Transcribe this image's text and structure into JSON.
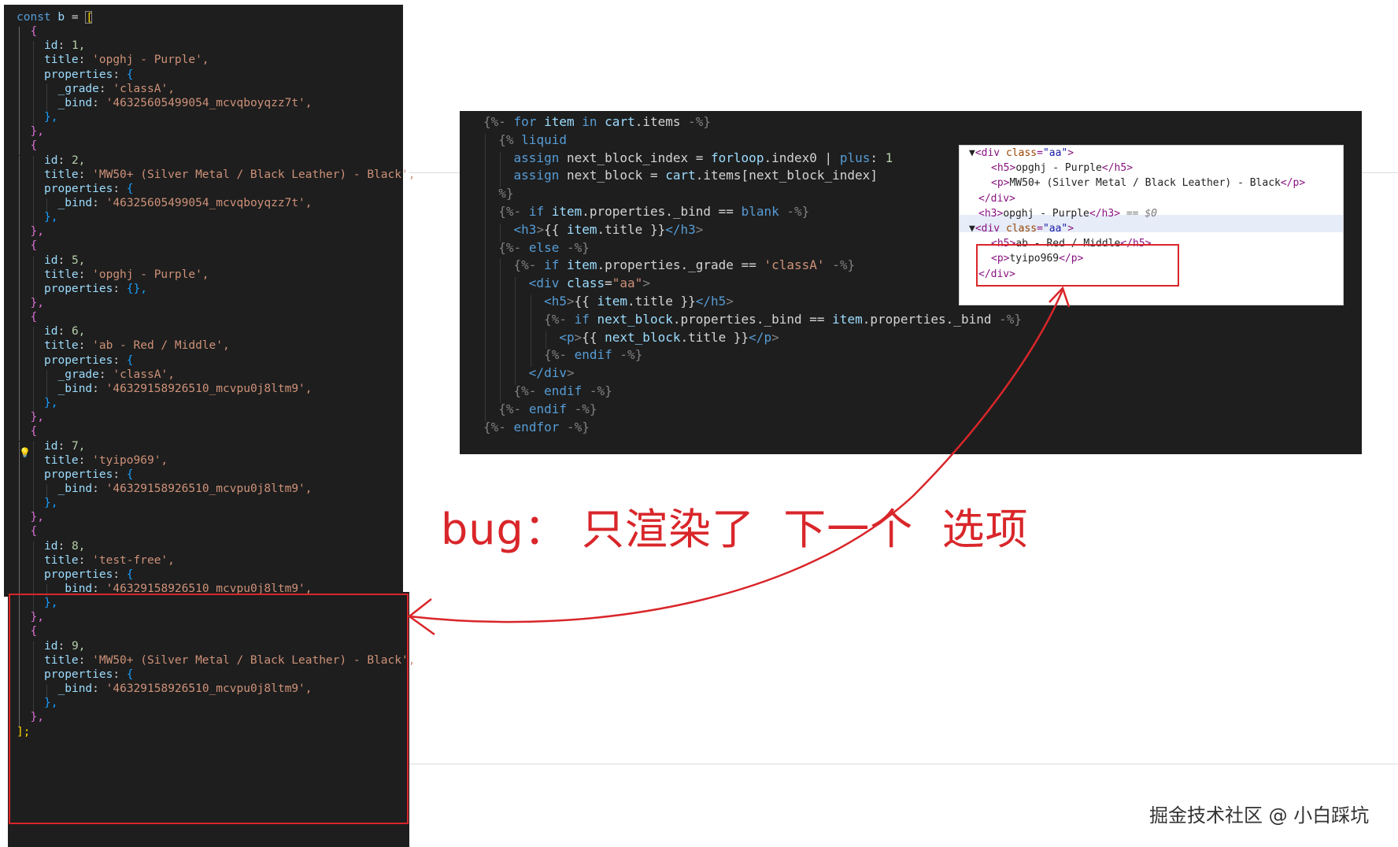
{
  "left_code": {
    "lines": [
      {
        "indent": 0,
        "text": "const b = [",
        "kind": "decl"
      },
      {
        "indent": 1,
        "text": "{",
        "kind": "brace"
      },
      {
        "indent": 2,
        "key": "id",
        "value": "1,",
        "vkind": "num"
      },
      {
        "indent": 2,
        "key": "title",
        "value": "'opghj - Purple',",
        "vkind": "str"
      },
      {
        "indent": 2,
        "key": "properties",
        "value": "{",
        "vkind": "brace"
      },
      {
        "indent": 3,
        "key": "_grade",
        "value": "'classA',",
        "vkind": "str"
      },
      {
        "indent": 3,
        "key": "_bind",
        "value": "'46325605499054_mcvqboyqzz7t',",
        "vkind": "str"
      },
      {
        "indent": 2,
        "text": "},",
        "kind": "brace"
      },
      {
        "indent": 1,
        "text": "},",
        "kind": "brace"
      },
      {
        "indent": 1,
        "text": "{",
        "kind": "brace"
      },
      {
        "indent": 2,
        "key": "id",
        "value": "2,",
        "vkind": "num"
      },
      {
        "indent": 2,
        "key": "title",
        "value": "'MW50+ (Silver Metal / Black Leather) - Black',",
        "vkind": "str"
      },
      {
        "indent": 2,
        "key": "properties",
        "value": "{",
        "vkind": "brace"
      },
      {
        "indent": 3,
        "key": "_bind",
        "value": "'46325605499054_mcvqboyqzz7t',",
        "vkind": "str"
      },
      {
        "indent": 2,
        "text": "},",
        "kind": "brace"
      },
      {
        "indent": 1,
        "text": "},",
        "kind": "brace"
      },
      {
        "indent": 1,
        "text": "{",
        "kind": "brace"
      },
      {
        "indent": 2,
        "key": "id",
        "value": "5,",
        "vkind": "num"
      },
      {
        "indent": 2,
        "key": "title",
        "value": "'opghj - Purple',",
        "vkind": "str"
      },
      {
        "indent": 2,
        "key": "properties",
        "value": "{},",
        "vkind": "brace"
      },
      {
        "indent": 1,
        "text": "},",
        "kind": "brace"
      },
      {
        "indent": 1,
        "text": "{",
        "kind": "brace"
      },
      {
        "indent": 2,
        "key": "id",
        "value": "6,",
        "vkind": "num"
      },
      {
        "indent": 2,
        "key": "title",
        "value": "'ab - Red / Middle',",
        "vkind": "str"
      },
      {
        "indent": 2,
        "key": "properties",
        "value": "{",
        "vkind": "brace"
      },
      {
        "indent": 3,
        "key": "_grade",
        "value": "'classA',",
        "vkind": "str"
      },
      {
        "indent": 3,
        "key": "_bind",
        "value": "'46329158926510_mcvpu0j8ltm9',",
        "vkind": "str"
      },
      {
        "indent": 2,
        "text": "},",
        "kind": "brace"
      },
      {
        "indent": 1,
        "text": "},",
        "kind": "brace"
      },
      {
        "indent": 1,
        "text": "{",
        "kind": "brace"
      },
      {
        "indent": 2,
        "key": "id",
        "value": "7,",
        "vkind": "num"
      },
      {
        "indent": 2,
        "key": "title",
        "value": "'tyipo969',",
        "vkind": "str"
      },
      {
        "indent": 2,
        "key": "properties",
        "value": "{",
        "vkind": "brace"
      },
      {
        "indent": 3,
        "key": "_bind",
        "value": "'46329158926510_mcvpu0j8ltm9',",
        "vkind": "str"
      },
      {
        "indent": 2,
        "text": "},",
        "kind": "brace"
      },
      {
        "indent": 1,
        "text": "},",
        "kind": "brace"
      },
      {
        "indent": 1,
        "text": "{",
        "kind": "brace"
      },
      {
        "indent": 2,
        "key": "id",
        "value": "8,",
        "vkind": "num"
      },
      {
        "indent": 2,
        "key": "title",
        "value": "'test-free',",
        "vkind": "str"
      },
      {
        "indent": 2,
        "key": "properties",
        "value": "{",
        "vkind": "brace"
      },
      {
        "indent": 3,
        "key": "_bind",
        "value": "'46329158926510_mcvpu0j8ltm9',",
        "vkind": "str"
      },
      {
        "indent": 2,
        "text": "},",
        "kind": "brace"
      },
      {
        "indent": 1,
        "text": "},",
        "kind": "brace"
      },
      {
        "indent": 1,
        "text": "{",
        "kind": "brace"
      },
      {
        "indent": 2,
        "key": "id",
        "value": "9,",
        "vkind": "num"
      },
      {
        "indent": 2,
        "key": "title",
        "value": "'MW50+ (Silver Metal / Black Leather) - Black',",
        "vkind": "str"
      },
      {
        "indent": 2,
        "key": "properties",
        "value": "{",
        "vkind": "brace"
      },
      {
        "indent": 3,
        "key": "_bind",
        "value": "'46329158926510_mcvpu0j8ltm9',",
        "vkind": "str"
      },
      {
        "indent": 2,
        "text": "},",
        "kind": "brace"
      },
      {
        "indent": 1,
        "text": "},",
        "kind": "brace"
      },
      {
        "indent": 0,
        "text": "];",
        "kind": "brace"
      }
    ]
  },
  "template_code": {
    "lines": [
      "{%- for item in cart.items -%}",
      "  {% liquid",
      "    assign next_block_index = forloop.index0 | plus: 1",
      "    assign next_block = cart.items[next_block_index]",
      "  %}",
      "  {%- if item.properties._bind == blank -%}",
      "    <h3>{{ item.title }}</h3>",
      "  {%- else -%}",
      "    {%- if item.properties._grade == 'classA' -%}",
      "      <div class=\"aa\">",
      "        <h5>{{ item.title }}</h5>",
      "        {%- if next_block.properties._bind == item.properties._bind -%}",
      "          <p>{{ next_block.title }}</p>",
      "        {%- endif -%}",
      "      </div>",
      "    {%- endif -%}",
      "  {%- endif -%}",
      "{%- endfor -%}"
    ]
  },
  "devtools": {
    "lines": [
      {
        "indent": 0,
        "arrow": "▼",
        "open": "<div ",
        "attr": "class",
        "val": "\"aa\"",
        "close": ">"
      },
      {
        "indent": 1,
        "tag_open": "<h5>",
        "text": "opghj - Purple",
        "tag_close": "</h5>"
      },
      {
        "indent": 1,
        "tag_open": "<p>",
        "text": "MW50+ (Silver Metal / Black Leather) - Black",
        "tag_close": "</p>"
      },
      {
        "indent": 0,
        "tag_open": "</div>",
        "text": "",
        "tag_close": ""
      },
      {
        "indent": 0,
        "tag_open": "<h3>",
        "text": "opghj - Purple",
        "tag_close": "</h3>",
        "ref": " == $0",
        "selected": true
      },
      {
        "indent": 0,
        "arrow": "▼",
        "open": "<div ",
        "attr": "class",
        "val": "\"aa\"",
        "close": ">"
      },
      {
        "indent": 1,
        "tag_open": "<h5>",
        "text": "ab - Red / Middle",
        "tag_close": "</h5>"
      },
      {
        "indent": 1,
        "tag_open": "<p>",
        "text": "tyipo969",
        "tag_close": "</p>"
      },
      {
        "indent": 0,
        "tag_open": "</div>",
        "text": "",
        "tag_close": ""
      }
    ]
  },
  "annotation": "bug： 只渲染了  下一个  选项",
  "watermark": "掘金技术社区 @ 小白踩坑",
  "colors": {
    "annotation_red": "#d9262a",
    "editor_bg": "#1e1e1e"
  }
}
